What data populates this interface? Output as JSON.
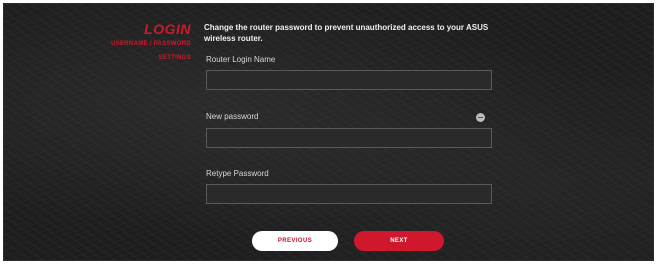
{
  "sidebar": {
    "title": "LOGIN",
    "subtitle": "USERNAME / PASSWORD",
    "subtitle2": "SETTINGS"
  },
  "main": {
    "description": "Change the router password to prevent unauthorized access to your ASUS wireless router.",
    "fields": [
      {
        "label": "Router Login Name",
        "value": "",
        "placeholder": ""
      },
      {
        "label": "New password",
        "value": "",
        "placeholder": "",
        "icon": "eye-icon"
      },
      {
        "label": "Retype Password",
        "value": "",
        "placeholder": ""
      }
    ]
  },
  "buttons": {
    "previous": "PREVIOUS",
    "next": "NEXT"
  },
  "colors": {
    "accent": "#d0182c",
    "background": "#1d1d1d",
    "input_border": "#5a5a5a"
  }
}
